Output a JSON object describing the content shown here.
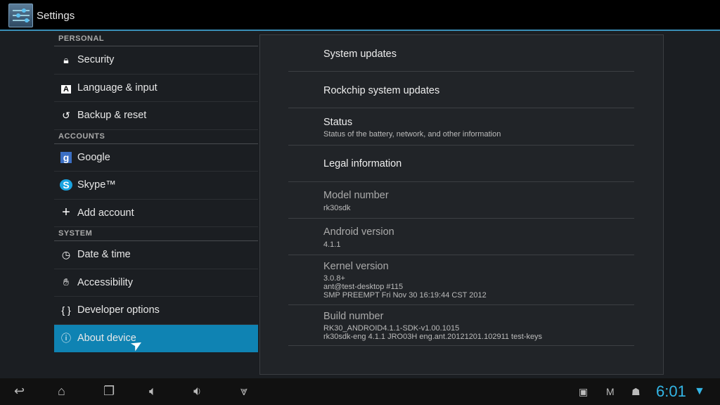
{
  "app": {
    "title": "Settings"
  },
  "sidebar": {
    "sections": [
      {
        "header": "PERSONAL",
        "items": [
          {
            "label": "Security",
            "icon": "lock-icon"
          },
          {
            "label": "Language & input",
            "icon": "keyboard-a-icon"
          },
          {
            "label": "Backup & reset",
            "icon": "restore-icon"
          }
        ]
      },
      {
        "header": "ACCOUNTS",
        "items": [
          {
            "label": "Google",
            "icon": "google-icon"
          },
          {
            "label": "Skype™",
            "icon": "skype-icon"
          },
          {
            "label": "Add account",
            "icon": "plus-icon"
          }
        ]
      },
      {
        "header": "SYSTEM",
        "items": [
          {
            "label": "Date & time",
            "icon": "clock-icon"
          },
          {
            "label": "Accessibility",
            "icon": "hand-icon"
          },
          {
            "label": "Developer options",
            "icon": "braces-icon"
          },
          {
            "label": "About device",
            "icon": "info-icon",
            "selected": true
          }
        ]
      }
    ]
  },
  "about": {
    "system_updates": "System updates",
    "rockchip_updates": "Rockchip system updates",
    "status": {
      "title": "Status",
      "summary": "Status of the battery, network, and other information"
    },
    "legal": "Legal information",
    "model": {
      "title": "Model number",
      "value": "rk30sdk"
    },
    "android": {
      "title": "Android version",
      "value": "4.1.1"
    },
    "kernel": {
      "title": "Kernel version",
      "line1": "3.0.8+",
      "line2": "ant@test-desktop #115",
      "line3": "SMP PREEMPT Fri Nov 30 16:19:44 CST 2012"
    },
    "build": {
      "title": "Build number",
      "line1": "RK30_ANDROID4.1.1-SDK-v1.00.1015",
      "line2": "rk30sdk-eng 4.1.1 JRO03H eng.ant.20121201.102911 test-keys"
    }
  },
  "statusbar": {
    "time": "6:01",
    "accent": "#33b5e5",
    "selected_color": "#0f83b3"
  }
}
